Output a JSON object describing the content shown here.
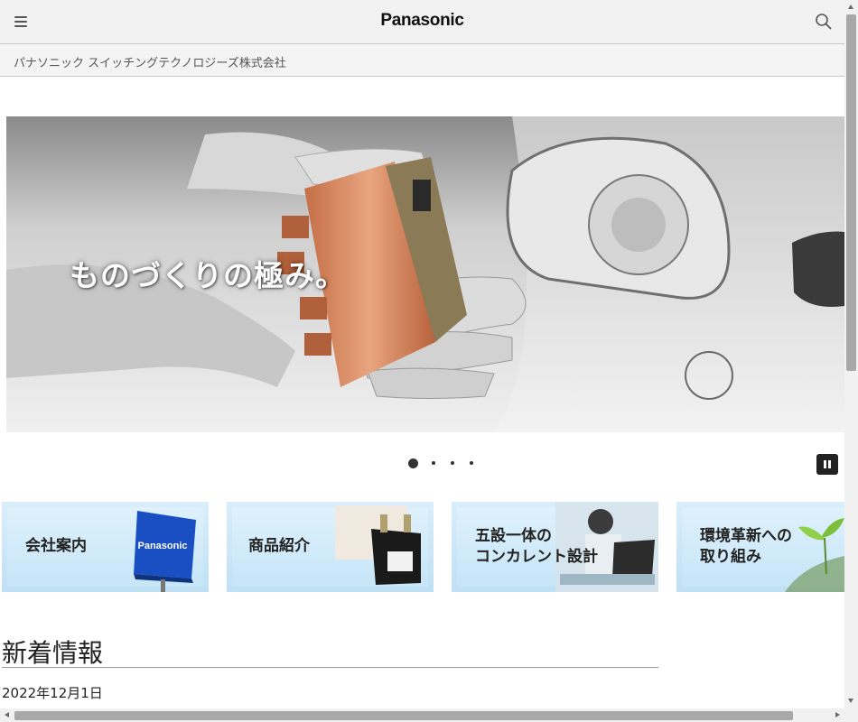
{
  "header": {
    "logo": "Panasonic",
    "menu_icon": "hamburger-menu-icon",
    "search_icon": "search-icon"
  },
  "subheader": {
    "company_name": "パナソニック スイッチングテクノロジーズ株式会社"
  },
  "hero": {
    "caption": "ものづくりの極み。",
    "slide_count": 4,
    "active_slide": 1,
    "pause_icon": "pause-icon"
  },
  "banners": [
    {
      "label": "会社案内",
      "image": "panasonic-sign-image"
    },
    {
      "label": "商品紹介",
      "image": "relay-product-image"
    },
    {
      "label": "五設一体の\nコンカレント設計",
      "image": "engineer-at-laptop-image"
    },
    {
      "label": "環境革新への\n取り組み",
      "image": "green-seedling-image"
    }
  ],
  "news": {
    "title": "新着情報",
    "items": [
      {
        "date": "2022年12月1日"
      }
    ]
  },
  "colors": {
    "header_bg": "#f2f2f2",
    "banner_blue": "#c6e5f7",
    "panasonic_blue": "#1a4fc4"
  }
}
